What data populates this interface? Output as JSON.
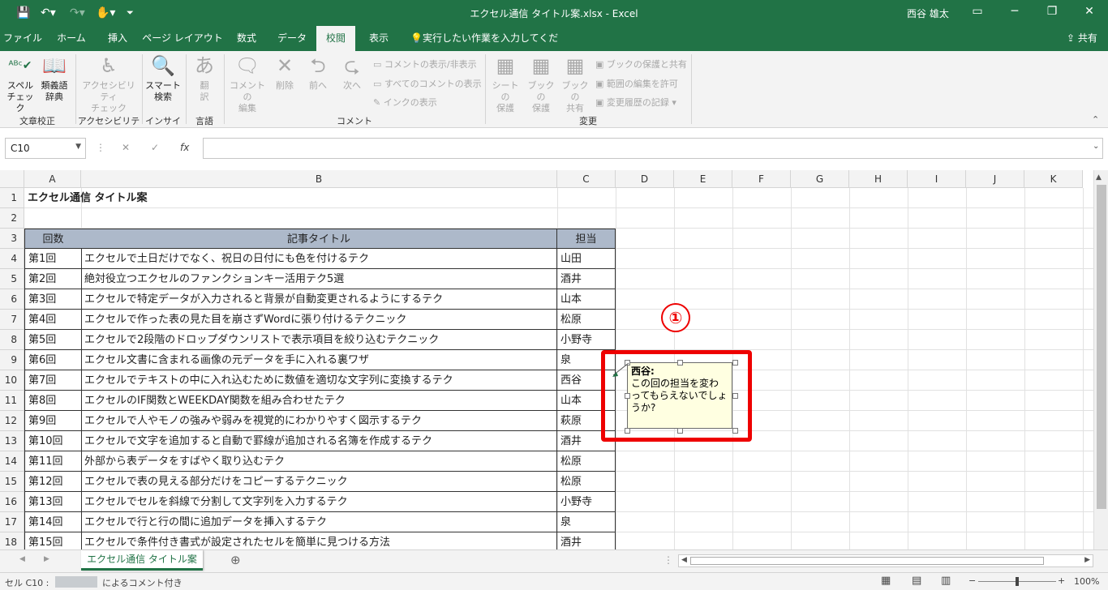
{
  "titlebar": {
    "title": "エクセル通信 タイトル案.xlsx  -  Excel",
    "user": "西谷 雄太",
    "icons": [
      "save-icon",
      "undo-icon",
      "redo-icon",
      "touch-mode-icon",
      "customize-icon"
    ]
  },
  "tabs": [
    "ファイル",
    "ホーム",
    "挿入",
    "ページ レイアウト",
    "数式",
    "データ",
    "校閲",
    "表示"
  ],
  "tell_me": "実行したい作業を入力してください",
  "share": "共有",
  "ribbon": {
    "spell": "スペル\nチェック",
    "thesaurus": "類義語\n辞典",
    "accessibility": "アクセシビリティ\nチェック",
    "smart_lookup": "スマート\n検索",
    "translate": "翻\n訳",
    "new_comment": "コメントの\n編集",
    "delete": "削除",
    "prev": "前へ",
    "next": "次へ",
    "show_hide": "コメントの表示/非表示",
    "show_all": "すべてのコメントの表示",
    "show_ink": "インクの表示",
    "protect_sheet": "シートの\n保護",
    "protect_book": "ブックの\n保護",
    "share_book": "ブックの\n共有",
    "protect_share": "ブックの保護と共有",
    "allow_edit": "範囲の編集を許可",
    "track_changes": "変更履歴の記録",
    "groups": [
      "文章校正",
      "アクセシビリティ",
      "インサイト",
      "言語",
      "コメント",
      "変更"
    ]
  },
  "namebox": "C10",
  "columns": [
    "A",
    "B",
    "C",
    "D",
    "E",
    "F",
    "G",
    "H",
    "I",
    "J",
    "K"
  ],
  "rows": [
    "1",
    "2",
    "3",
    "4",
    "5",
    "6",
    "7",
    "8",
    "9",
    "10",
    "11",
    "12",
    "13",
    "14",
    "15",
    "16",
    "17",
    "18"
  ],
  "sheet_title": "エクセル通信 タイトル案",
  "headers": [
    "回数",
    "記事タイトル",
    "担当"
  ],
  "data": [
    [
      "第1回",
      "エクセルで土日だけでなく、祝日の日付にも色を付けるテク",
      "山田"
    ],
    [
      "第2回",
      "絶対役立つエクセルのファンクションキー活用テク5選",
      "酒井"
    ],
    [
      "第3回",
      "エクセルで特定データが入力されると背景が自動変更されるようにするテク",
      "山本"
    ],
    [
      "第4回",
      "エクセルで作った表の見た目を崩さずWordに張り付けるテクニック",
      "松原"
    ],
    [
      "第5回",
      "エクセルで2段階のドロップダウンリストで表示項目を絞り込むテクニック",
      "小野寺"
    ],
    [
      "第6回",
      "エクセル文書に含まれる画像の元データを手に入れる裏ワザ",
      "泉"
    ],
    [
      "第7回",
      "エクセルでテキストの中に入れ込むために数値を適切な文字列に変換するテク",
      "西谷"
    ],
    [
      "第8回",
      "エクセルのIF関数とWEEKDAY関数を組み合わせたテク",
      "山本"
    ],
    [
      "第9回",
      "エクセルで人やモノの強みや弱みを視覚的にわかりやすく図示するテク",
      "萩原"
    ],
    [
      "第10回",
      "エクセルで文字を追加すると自動で罫線が追加される名簿を作成するテク",
      "酒井"
    ],
    [
      "第11回",
      "外部から表データをすばやく取り込むテク",
      "松原"
    ],
    [
      "第12回",
      "エクセルで表の見える部分だけをコピーするテクニック",
      "松原"
    ],
    [
      "第13回",
      "エクセルでセルを斜線で分割して文字列を入力するテク",
      "小野寺"
    ],
    [
      "第14回",
      "エクセルで行と行の間に追加データを挿入するテク",
      "泉"
    ],
    [
      "第15回",
      "エクセルで条件付き書式が設定されたセルを簡単に見つける方法",
      "酒井"
    ]
  ],
  "comment": {
    "author": "西谷:",
    "text": "この回の担当を変わってもらえないでしょうか?"
  },
  "annotation": "①",
  "sheet_tab": "エクセル通信 タイトル案",
  "status": {
    "prefix": "セル C10 :",
    "suffix": "によるコメント付き",
    "zoom": "100%"
  }
}
